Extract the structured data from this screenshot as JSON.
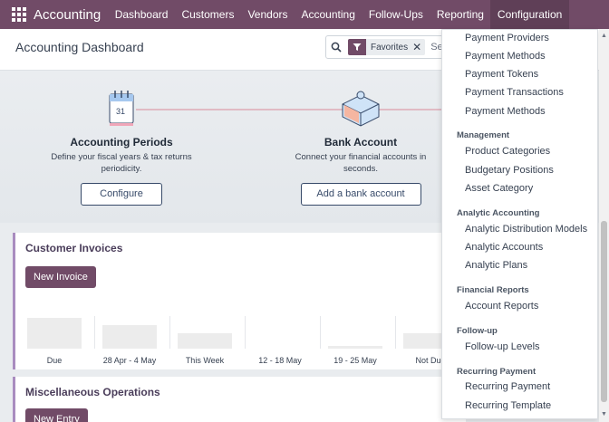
{
  "navbar": {
    "app_name": "Accounting",
    "items": [
      "Dashboard",
      "Customers",
      "Vendors",
      "Accounting",
      "Follow-Ups",
      "Reporting",
      "Configuration"
    ],
    "active": "Configuration"
  },
  "control": {
    "title": "Accounting Dashboard",
    "facet_label": "Favorites",
    "search_placeholder": "Se"
  },
  "onboarding": {
    "steps": [
      {
        "title": "Accounting Periods",
        "desc_line1": "Define your fiscal years & tax returns",
        "desc_line2": "periodicity.",
        "button": "Configure"
      },
      {
        "title": "Bank Account",
        "desc_line1": "Connect your financial accounts in",
        "desc_line2": "seconds.",
        "button": "Add a bank account"
      }
    ]
  },
  "customer_invoices": {
    "title": "Customer Invoices",
    "button": "New Invoice",
    "chart_data": {
      "type": "bar",
      "categories": [
        "Due",
        "28 Apr - 4 May",
        "This Week",
        "12 - 18 May",
        "19 - 25 May",
        "Not Due"
      ],
      "values": [
        30,
        23,
        15,
        0,
        3,
        15
      ]
    }
  },
  "misc_operations": {
    "title": "Miscellaneous Operations",
    "button": "New Entry"
  },
  "dropdown": {
    "groups": [
      {
        "header": "",
        "items": [
          "Payment Providers",
          "Payment Methods",
          "Payment Tokens",
          "Payment Transactions",
          "Payment Methods"
        ]
      },
      {
        "header": "Management",
        "items": [
          "Product Categories",
          "Budgetary Positions",
          "Asset Category"
        ]
      },
      {
        "header": "Analytic Accounting",
        "items": [
          "Analytic Distribution Models",
          "Analytic Accounts",
          "Analytic Plans"
        ]
      },
      {
        "header": "Financial Reports",
        "items": [
          "Account Reports"
        ]
      },
      {
        "header": "Follow-up",
        "items": [
          "Follow-up Levels"
        ]
      },
      {
        "header": "Recurring Payment",
        "items": [
          "Recurring Payment",
          "Recurring Template"
        ]
      }
    ]
  },
  "colors": {
    "brand": "#714b67",
    "accent_border": "#a98cbf"
  }
}
